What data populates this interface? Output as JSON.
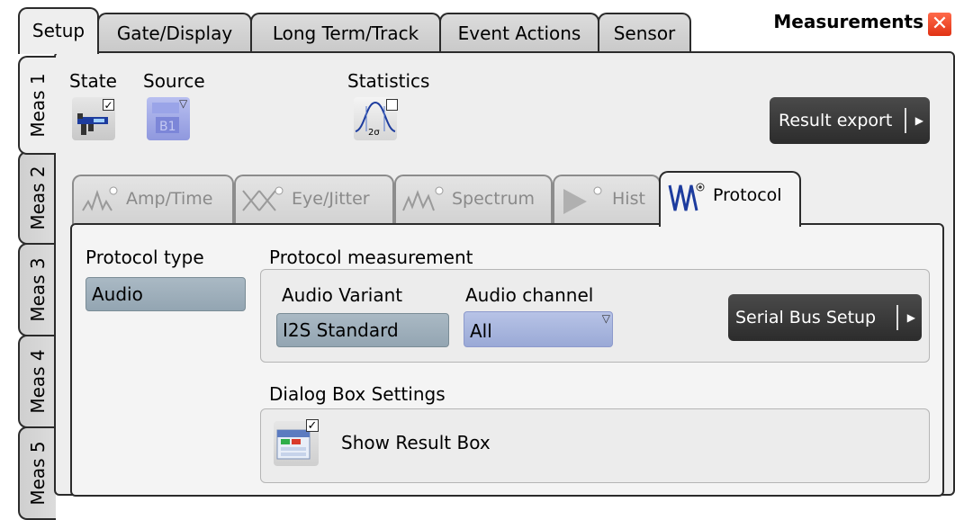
{
  "window": {
    "title": "Measurements",
    "close_icon": "close-icon"
  },
  "top_tabs": [
    {
      "label": "Setup",
      "active": true
    },
    {
      "label": "Gate/Display",
      "active": false
    },
    {
      "label": "Long Term/Track",
      "active": false
    },
    {
      "label": "Event Actions",
      "active": false
    },
    {
      "label": "Sensor",
      "active": false
    }
  ],
  "side_tabs": [
    {
      "label": "Meas 1",
      "active": true
    },
    {
      "label": "Meas 2",
      "active": false
    },
    {
      "label": "Meas 3",
      "active": false
    },
    {
      "label": "Meas 4",
      "active": false
    },
    {
      "label": "Meas 5",
      "active": false
    }
  ],
  "header": {
    "state_label": "State",
    "source_label": "Source",
    "statistics_label": "Statistics",
    "statistics_sigma": "2σ",
    "state_checked": true,
    "statistics_checked": false,
    "result_export_label": "Result export"
  },
  "category_tabs": [
    {
      "label": "Amp/Time",
      "active": false,
      "icon": "amp-time-icon"
    },
    {
      "label": "Eye/Jitter",
      "active": false,
      "icon": "eye-jitter-icon"
    },
    {
      "label": "Spectrum",
      "active": false,
      "icon": "spectrum-icon"
    },
    {
      "label": "Hist",
      "active": false,
      "icon": "histogram-icon"
    },
    {
      "label": "Protocol",
      "active": true,
      "icon": "protocol-icon"
    }
  ],
  "protocol": {
    "type_label": "Protocol type",
    "type_value": "Audio",
    "measurement_label": "Protocol measurement",
    "variant_label": "Audio Variant",
    "variant_value": "I2S Standard",
    "channel_label": "Audio channel",
    "channel_value": "All",
    "serial_bus_setup_label": "Serial Bus Setup"
  },
  "dialog_box": {
    "section_label": "Dialog Box Settings",
    "show_result_box_label": "Show Result Box",
    "show_result_box_checked": true
  },
  "colors": {
    "accent_blue": "#3b5fc4",
    "close_red": "#e13214",
    "button_dark": "#333333",
    "field_blue": "#9fb0bd"
  }
}
